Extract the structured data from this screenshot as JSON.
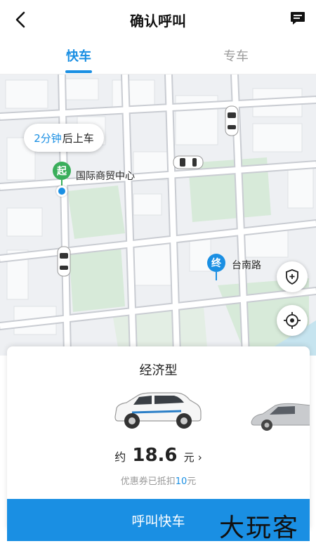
{
  "header": {
    "title": "确认呼叫",
    "back_icon": "chevron-left-icon",
    "message_icon": "message-icon"
  },
  "tabs": [
    {
      "label": "快车",
      "active": true
    },
    {
      "label": "专车",
      "active": false
    }
  ],
  "map": {
    "eta_prefix": "2分钟",
    "eta_suffix": "后上车",
    "start_marker": "起",
    "start_name": "国际商贸中心",
    "end_marker": "终",
    "end_name": "台南路",
    "safety_icon": "shield-plus-icon",
    "locate_icon": "locate-icon"
  },
  "ride": {
    "type": "经济型",
    "price_prefix": "约",
    "price": "18.6",
    "price_unit": "元",
    "coupon_text": "优惠券已抵扣",
    "coupon_amount": "10",
    "coupon_unit": "元"
  },
  "action": {
    "call_label": "呼叫快车"
  },
  "watermark": "大玩客",
  "colors": {
    "accent": "#1a8fe3",
    "start_green": "#3aae5b"
  }
}
